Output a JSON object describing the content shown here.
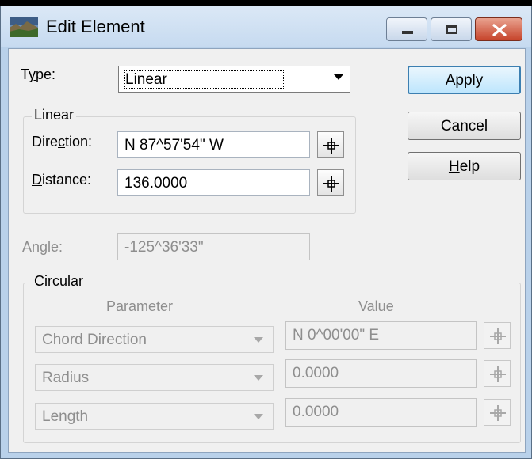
{
  "window": {
    "title": "Edit Element",
    "icon": "landscape-app-icon"
  },
  "type_row": {
    "label_pre": "T",
    "label_mnemonic": "y",
    "label_post": "pe:",
    "value": "Linear"
  },
  "linear": {
    "group_title": "Linear",
    "direction_label_pre": "Dire",
    "direction_label_mnemonic": "c",
    "direction_label_post": "tion:",
    "direction_value": "N 87^57'54\" W",
    "distance_label_mnemonic": "D",
    "distance_label_post": "istance:",
    "distance_value": "136.0000"
  },
  "angle": {
    "label": "Angle:",
    "value": "-125^36'33\""
  },
  "circular": {
    "group_title": "Circular",
    "col_parameter": "Parameter",
    "col_value": "Value",
    "rows": [
      {
        "parameter": "Chord Direction",
        "value": "N  0^00'00\" E"
      },
      {
        "parameter": "Radius",
        "value": "0.0000"
      },
      {
        "parameter": "Length",
        "value": "0.0000"
      }
    ]
  },
  "buttons": {
    "apply": "Apply",
    "cancel": "Cancel",
    "help_mnemonic": "H",
    "help_post": "elp"
  },
  "colors": {
    "title_bar": "#c6daf0",
    "close_button": "#c6432a",
    "default_button_border": "#3c7fb1"
  }
}
